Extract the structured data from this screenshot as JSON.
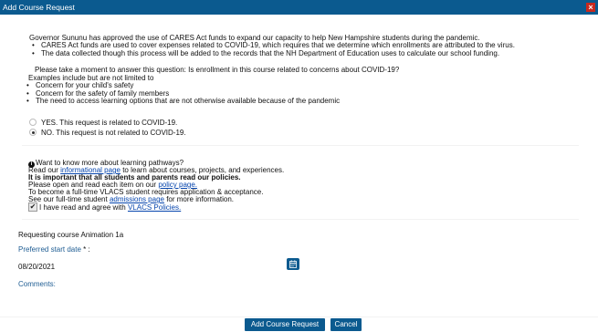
{
  "titlebar": {
    "title": "Add Course Request",
    "close_icon": "close-icon"
  },
  "intro": {
    "line1": "Governor Sununu has approved the use of CARES Act funds to expand our capacity to help New Hampshire students during the pandemic.",
    "bullets": [
      "CARES Act funds are used to cover expenses related to COVID-19, which requires that we determine which enrollments are attributed to the virus.",
      "The data collected though this process will be added to the records that the NH Department of Education uses to calculate our school funding."
    ],
    "question": "Please take a moment to answer this question: Is enrollment in this course related to concerns about COVID-19?",
    "examples": "Examples include but are not limited to",
    "example_bullets": [
      "Concern for your child's safety",
      "Concern for the safety of family members",
      "The need to access learning options that are not otherwise available because of the pandemic"
    ]
  },
  "covid_options": [
    {
      "label": "YES. This request is related to COVID-19.",
      "checked": false
    },
    {
      "label": "NO. This request is not related to COVID-19.",
      "checked": true
    }
  ],
  "pathways": {
    "info_icon": "info-icon",
    "heading": "Want to know more about learning pathways?",
    "read_prefix": "Read our ",
    "informational_link": "informational page",
    "read_suffix": " to learn about courses, projects, and experiences.",
    "important": "It is important that all students and parents read our policies.",
    "policy_prefix": "Please open and read each item on our ",
    "policy_link": "policy page.",
    "fulltime": "To become a full-time VLACS student requires application & acceptance.",
    "admissions_prefix": "See our full-time student ",
    "admissions_link": "admissions page",
    "admissions_suffix": " for more information.",
    "agree_prefix": "I have read and agree with ",
    "agree_link": "VLACS Policies.",
    "agree_checked": true
  },
  "form": {
    "requesting": "Requesting course Animation 1a",
    "start_date_label": "Preferred start date",
    "required_marker": "*",
    "start_date_suffix": " :",
    "start_date_value": "08/20/2021",
    "calendar_icon": "calendar-icon",
    "comments_label": "Comments:",
    "comments_value": ""
  },
  "buttons": {
    "submit": "Add Course Request",
    "cancel": "Cancel"
  },
  "colors": {
    "titlebar": "#0b5a8f",
    "close": "#c8291e",
    "link": "#0645ad",
    "label_blue": "#1f5d93"
  }
}
